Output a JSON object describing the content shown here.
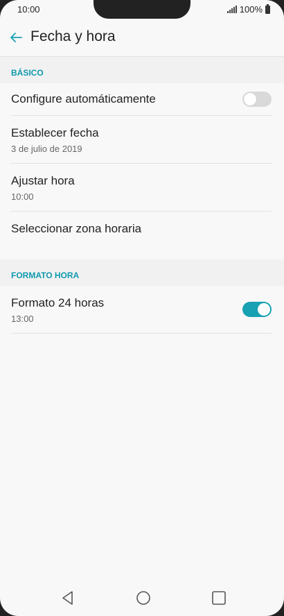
{
  "status_bar": {
    "time": "10:00",
    "battery": "100%"
  },
  "header": {
    "title": "Fecha y hora"
  },
  "sections": {
    "basic": {
      "label": "BÁSICO"
    },
    "time_format": {
      "label": "FORMATO HORA"
    }
  },
  "settings": {
    "auto_configure": {
      "title": "Configure automáticamente",
      "enabled": false
    },
    "set_date": {
      "title": "Establecer fecha",
      "value": "3 de julio de 2019"
    },
    "set_time": {
      "title": "Ajustar hora",
      "value": "10:00"
    },
    "time_zone": {
      "title": "Seleccionar zona horaria"
    },
    "format_24h": {
      "title": "Formato 24 horas",
      "value": "13:00",
      "enabled": true
    }
  },
  "colors": {
    "accent": "#17a1b2",
    "section_text": "#0f9aae",
    "background": "#f8f8f8"
  },
  "icons": {
    "back": "arrow-left-icon",
    "signal": "signal-icon",
    "battery": "battery-icon",
    "nav_back": "triangle-back-icon",
    "nav_home": "circle-home-icon",
    "nav_recent": "square-recent-icon"
  }
}
